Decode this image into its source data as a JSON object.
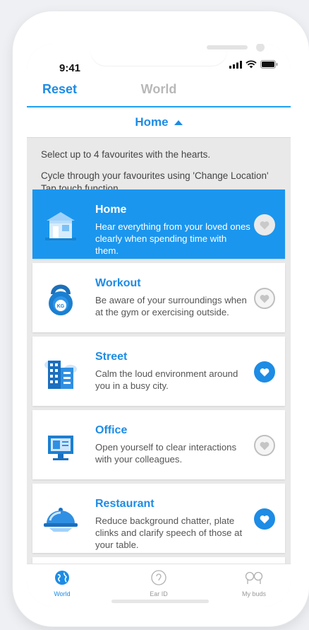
{
  "status": {
    "time": "9:41"
  },
  "nav": {
    "reset_label": "Reset",
    "title": "World"
  },
  "dropdown": {
    "selected": "Home"
  },
  "instructions": {
    "line1": "Select up to 4 favourites with the hearts.",
    "line2": "Cycle through your favourites using 'Change Location' Tap touch function."
  },
  "locations": [
    {
      "title": "Home",
      "desc": "Hear everything from your loved ones clearly when spending time with them.",
      "icon": "house-icon",
      "favourite": false,
      "active": true
    },
    {
      "title": "Workout",
      "desc": "Be aware of your surroundings when at the gym or exercising outside.",
      "icon": "kettlebell-icon",
      "favourite": false,
      "active": false
    },
    {
      "title": "Street",
      "desc": "Calm the loud environment around you in a busy city.",
      "icon": "city-buildings-icon",
      "favourite": true,
      "active": false
    },
    {
      "title": "Office",
      "desc": "Open yourself to clear interactions with your colleagues.",
      "icon": "computer-monitor-icon",
      "favourite": false,
      "active": false
    },
    {
      "title": "Restaurant",
      "desc": "Reduce background chatter, plate clinks and clarify speech of those at your table.",
      "icon": "cloche-icon",
      "favourite": true,
      "active": false
    }
  ],
  "tabs": {
    "world": "World",
    "ear_id": "Ear ID",
    "my_buds": "My buds"
  },
  "colors": {
    "accent": "#1d8ce5",
    "active_card": "#1b96ee"
  }
}
